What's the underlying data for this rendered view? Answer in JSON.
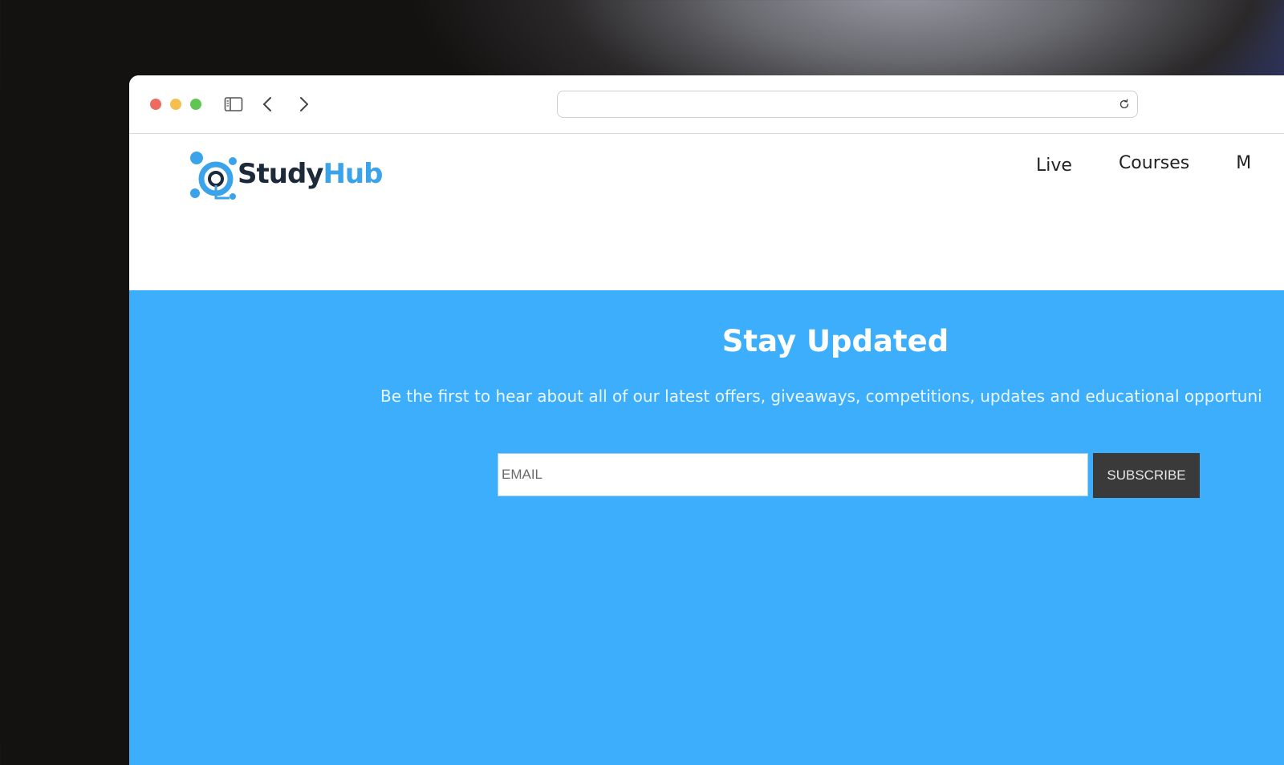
{
  "browser": {
    "url": ""
  },
  "site": {
    "logo": {
      "part1": "Study",
      "part2": "Hub"
    },
    "nav": [
      {
        "label": "Live"
      },
      {
        "label": "Courses"
      },
      {
        "label": "M"
      }
    ]
  },
  "newsletter": {
    "title": "Stay Updated",
    "subtitle": "Be the first to hear about all of our latest offers, giveaways, competitions, updates and educational opportuni",
    "email_placeholder": "EMAIL",
    "subscribe_label": "SUBSCRIBE"
  },
  "colors": {
    "hero_background": "#3daefc",
    "logo_dark": "#1d2a3a",
    "logo_blue": "#3aa3ea",
    "button_background": "#3a3a3a"
  }
}
